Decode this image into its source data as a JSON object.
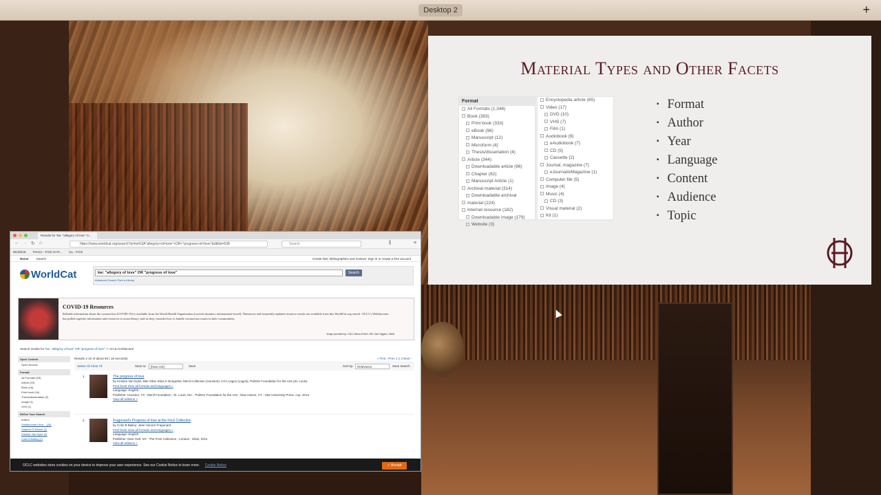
{
  "menubar": {
    "desktop_label": "Desktop 2",
    "plus_icon": "+"
  },
  "slide": {
    "title": "Material Types and Other Facets",
    "facets_col1": [
      {
        "label": "Format",
        "type": "head"
      },
      {
        "label": "All Formats (1,348)",
        "level": 0
      },
      {
        "label": "Book (393)",
        "level": 0
      },
      {
        "label": "Print book (333)",
        "level": 1
      },
      {
        "label": "eBook (96)",
        "level": 1
      },
      {
        "label": "Manuscript (12)",
        "level": 1
      },
      {
        "label": "Microform (4)",
        "level": 1
      },
      {
        "label": "Thesis/dissertation (4)",
        "level": 1
      },
      {
        "label": "Article (344)",
        "level": 0
      },
      {
        "label": "Downloadable article (96)",
        "level": 1
      },
      {
        "label": "Chapter (82)",
        "level": 1
      },
      {
        "label": "Manuscript Article (1)",
        "level": 1
      },
      {
        "label": "Archival material (314)",
        "level": 0
      },
      {
        "label": "Downloadable archival",
        "level": 1
      },
      {
        "label": "material (224)",
        "level": 0
      },
      {
        "label": "Internet resource (182)",
        "level": 0
      },
      {
        "label": "Downloadable image (179)",
        "level": 1
      },
      {
        "label": "Website (3)",
        "level": 1
      }
    ],
    "facets_col2": [
      {
        "label": "Encyclopedia article (65)",
        "level": 0
      },
      {
        "label": "Video (17)",
        "level": 0
      },
      {
        "label": "DVD (10)",
        "level": 1
      },
      {
        "label": "VHS (7)",
        "level": 1
      },
      {
        "label": "Film (1)",
        "level": 1
      },
      {
        "label": "Audiobook (9)",
        "level": 0
      },
      {
        "label": "eAudiobook (7)",
        "level": 1
      },
      {
        "label": "CD (5)",
        "level": 1
      },
      {
        "label": "Cassette (2)",
        "level": 1
      },
      {
        "label": "Journal, magazine (7)",
        "level": 0
      },
      {
        "label": "eJournal/eMagazine (1)",
        "level": 1
      },
      {
        "label": "Computer file (5)",
        "level": 0
      },
      {
        "label": "Image (4)",
        "level": 0
      },
      {
        "label": "Music (4)",
        "level": 0
      },
      {
        "label": "CD (3)",
        "level": 1
      },
      {
        "label": "Visual material (2)",
        "level": 0
      },
      {
        "label": "Kit (1)",
        "level": 0
      }
    ],
    "bullets": [
      "Format",
      "Author",
      "Year",
      "Language",
      "Content",
      "Audience",
      "Topic"
    ]
  },
  "browser": {
    "tab_title": "Results for 'kw: \"allegory of love\" O...",
    "url": "https://www.worldcat.org/search?q=kw%3A\"allegory+of+love\"+OR+\"progress+of+love\"&dblist=638",
    "search_placeholder": "Search",
    "bookmarks": [
      "WorldCat",
      "Fresco - Frick Art R...",
      "ILL - Frick"
    ],
    "nav_home": "Home",
    "nav_search": "Search",
    "nav_right": "Create lists, bibliographies and reviews:  Sign in or create a free account",
    "logo": "WorldCat",
    "query": "kw: \"allegory of love\" OR \"progress of love\"",
    "search_button": "Search",
    "advanced": "Advanced Search    Find a Library",
    "covid_title": "COVID-19 Resources",
    "covid_text": "Reliable information about the coronavirus (COVID-19) is available from the World Health Organization (current situation, international travel). Numerous and frequently-updated resource results are available from this WorldCat.org search. OCLC's WebJunction has pulled together information and resources to assist library staff as they consider how to handle coronavirus issues in their communities.",
    "covid_credit": "Image provided by: CDC/ Alissa Eckert, MS; Dan Higgins, MAM",
    "results_for_prefix": "Search results for",
    "results_for_query": "'kw: \"allegory of love\" OR \"progress of love\"'",
    "results_for_suffix": "> 'Art & Architecture'",
    "left_facets": [
      {
        "label": "Open Content",
        "type": "head"
      },
      {
        "label": "Open Access",
        "type": "row"
      },
      {
        "label": "Format",
        "type": "head"
      },
      {
        "label": "All Formats (59)",
        "type": "row"
      },
      {
        "label": "Article (23)",
        "type": "row"
      },
      {
        "label": "Book (18)",
        "type": "row"
      },
      {
        "label": "Print book (16)",
        "type": "row"
      },
      {
        "label": "Thesis/dissertation (2)",
        "type": "row"
      },
      {
        "label": "Image (1)",
        "type": "row"
      },
      {
        "label": "VHS (1)",
        "type": "row"
      },
      {
        "label": "Refine Your Search",
        "type": "head"
      },
      {
        "label": "Author",
        "type": "row"
      },
      {
        "label": "Smithsonian Libra... (26)",
        "type": "link"
      },
      {
        "label": "Stephen D Bonse (2)",
        "type": "link"
      },
      {
        "label": "Kristina Van Dyke (2)",
        "type": "link"
      },
      {
        "label": "Colin B Bailey (1)",
        "type": "link"
      }
    ],
    "results_count": "Results 1-10 of about 60 ( 16 seconds)",
    "pagination": "« First  ‹ Prev  1  2  3  Next ›",
    "select_all": "Select All  Clear All",
    "save_to": "Save to:",
    "save_list": "[New List]",
    "save": "Save",
    "sort_by": "Sort by:",
    "sort_value": "Relevance",
    "save_search": "Save Search",
    "results": [
      {
        "num": "1.",
        "title": "The progress of love",
        "meta": [
          "by Kristina Van Dyke; Blai Silva; Elias K Bongmba; Menil Collection (Houston); CCA Lagos (Lagos); Pulitzer Foundation for the Arts (St. Louis)",
          "Print book   View all formats and languages »",
          "Language: English",
          "Publisher: Houston, TX : Menil Foundation ; St. Louis, Mo. : Pulitzer Foundation for the Arts ; New Haven, CT : Yale University Press, cop. 2012.",
          "View all editions »"
        ]
      },
      {
        "num": "2.",
        "title": "Fragonard's Progress of love at the Frick Collection",
        "meta": [
          "by Colin B Bailey; Jean Honoré Fragonard",
          "Print book   View all formats and languages »",
          "Language: English",
          "Publisher: New York, NY : The Frick Collection ; London : Gilas, 2011",
          "View all editions »"
        ]
      }
    ],
    "cookie_text": "OCLC websites store cookies on your device to improve your user experience. See our Cookie Notice to learn more.",
    "cookie_link": "Cookie Notice",
    "accept": "✓ Accept"
  }
}
